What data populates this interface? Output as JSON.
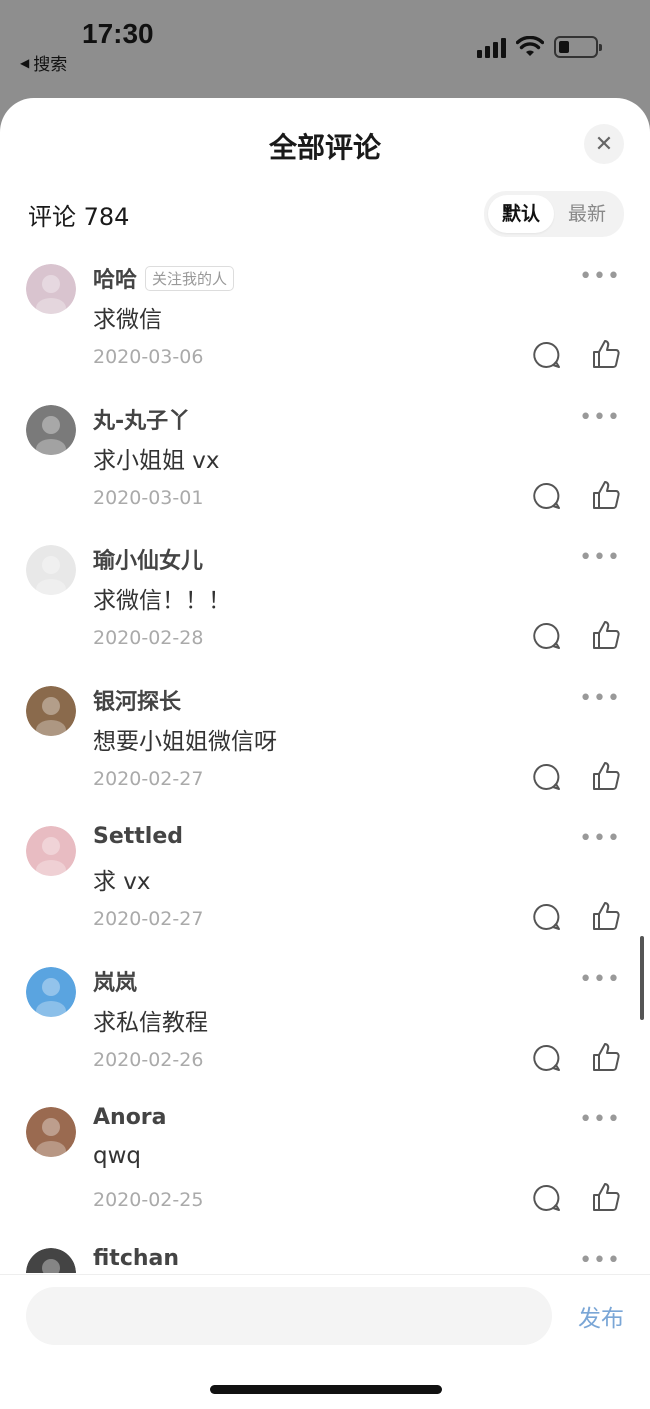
{
  "status_bar": {
    "time": "17:30",
    "back_label": "搜索"
  },
  "sheet": {
    "title": "全部评论",
    "count_label": "评论 784",
    "sort": {
      "default": "默认",
      "latest": "最新",
      "active": "default"
    }
  },
  "comments": [
    {
      "username": "哈哈",
      "tag": "关注我的人",
      "text": "求微信",
      "date": "2020-03-06",
      "avatar_color": "#d9c4cf"
    },
    {
      "username": "丸-丸子丫",
      "tag": "",
      "text": "求小姐姐 vx",
      "date": "2020-03-01",
      "avatar_color": "#7a7a7a"
    },
    {
      "username": "瑜小仙女儿",
      "tag": "",
      "text": "求微信！！！",
      "date": "2020-02-28",
      "avatar_color": "#e8e8e8"
    },
    {
      "username": "银河探长",
      "tag": "",
      "text": "想要小姐姐微信呀",
      "date": "2020-02-27",
      "avatar_color": "#8a6a4c"
    },
    {
      "username": "Settled",
      "tag": "",
      "text": "求 vx",
      "date": "2020-02-27",
      "avatar_color": "#e8bcc2"
    },
    {
      "username": "岚岚",
      "tag": "",
      "text": "求私信教程",
      "date": "2020-02-26",
      "avatar_color": "#5aa4e0"
    },
    {
      "username": "Anora",
      "tag": "",
      "text": "qwq",
      "date": "2020-02-25",
      "avatar_color": "#9a6a50"
    },
    {
      "username": "fitchan",
      "tag": "",
      "text": "",
      "date": "",
      "avatar_color": "#444444"
    }
  ],
  "input_bar": {
    "placeholder": "",
    "publish_label": "发布"
  },
  "colors": {
    "backdrop": "#8e8e8e",
    "publish": "#7aa6d6"
  }
}
